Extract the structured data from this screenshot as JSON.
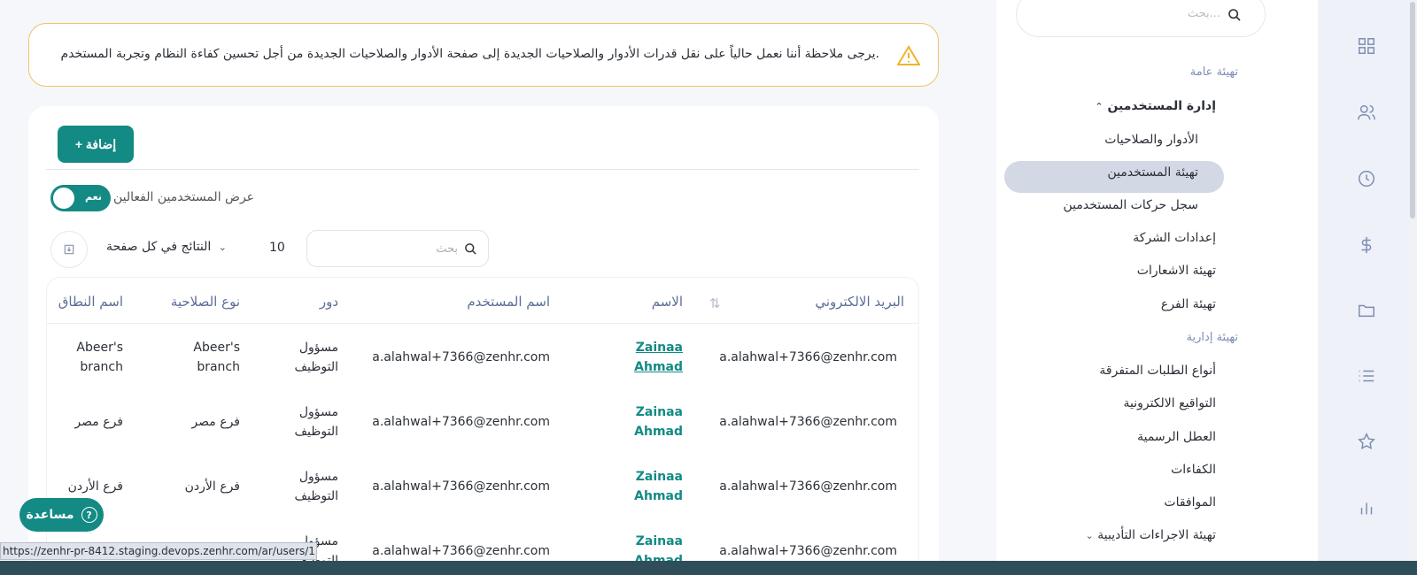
{
  "sidebar": {
    "search_placeholder": "بحث...",
    "section_general": "تهيئة عامة",
    "users_management": "إدارة المستخدمين",
    "items_users": [
      "الأدوار والصلاحيات",
      "تهيئة المستخدمين",
      "سجل حركات المستخدمين"
    ],
    "items_general": [
      "إعدادات الشركة",
      "تهيئة الاشعارات",
      "تهيئة الفرع"
    ],
    "section_admin": "تهيئة إدارية",
    "items_admin": [
      "أنواع الطلبات المتفرقة",
      "التواقيع الالكترونية",
      "العطل الرسمية",
      "الكفاءات",
      "الموافقات",
      "تهيئة الاجراءات التأديبية"
    ],
    "active_item": "تهيئة المستخدمين"
  },
  "rail_icons": [
    "dashboard-icon",
    "users-icon",
    "clock-icon",
    "dollar-icon",
    "folder-icon",
    "list-icon",
    "star-icon",
    "chart-icon"
  ],
  "notice": {
    "text": "يرجى ملاحظة أننا نعمل حالياً على نقل قدرات الأدوار والصلاحيات الجديدة إلى صفحة الأدوار والصلاحيات الجديدة من أجل تحسين كفاءة النظام وتجربة المستخدم."
  },
  "toolbar": {
    "add_label": "+ إضافة",
    "toggle_label": "نعم",
    "toggle_text": "عرض المستخدمين الفعالين",
    "per_page_label": "النتائج في كل صفحة",
    "per_page_value": "10",
    "search_placeholder": "بحث"
  },
  "table": {
    "headers": {
      "email": "البريد الالكتروني",
      "name": "الاسم",
      "username": "اسم المستخدم",
      "role": "دور",
      "permission_type": "نوع الصلاحية",
      "scope_name": "اسم النطاق"
    },
    "rows": [
      {
        "email": "a.alahwal+7366@zenhr.com",
        "name1": "Zainaa",
        "name2": "Ahmad",
        "username": "a.alahwal+7366@zenhr.com",
        "role1": "مسؤول",
        "role2": "التوظيف",
        "perm1": "Abeer's",
        "perm2": "branch",
        "scope1": "Abeer's",
        "scope2": "branch"
      },
      {
        "email": "a.alahwal+7366@zenhr.com",
        "name1": "Zainaa",
        "name2": "Ahmad",
        "username": "a.alahwal+7366@zenhr.com",
        "role1": "مسؤول",
        "role2": "التوظيف",
        "perm1": "فرع مصر",
        "perm2": "",
        "scope1": "فرع مصر",
        "scope2": ""
      },
      {
        "email": "a.alahwal+7366@zenhr.com",
        "name1": "Zainaa",
        "name2": "Ahmad",
        "username": "a.alahwal+7366@zenhr.com",
        "role1": "مسؤول",
        "role2": "التوظيف",
        "perm1": "فرع الأردن",
        "perm2": "",
        "scope1": "فرع الأردن",
        "scope2": ""
      },
      {
        "email": "a.alahwal+7366@zenhr.com",
        "name1": "Zainaa",
        "name2": "Ahmad",
        "username": "a.alahwal+7366@zenhr.com",
        "role1": "مسؤول",
        "role2": "التوظيف",
        "perm1": "",
        "perm2": "",
        "scope1": "",
        "scope2": ""
      }
    ]
  },
  "help_label": "مساعدة",
  "status_url": "https://zenhr-pr-8412.staging.devops.zenhr.com/ar/users/171260",
  "colors": {
    "accent": "#138a84",
    "notice_border": "#f2c265",
    "rail_icon": "#7d8cb4",
    "header_text": "#5b6e98"
  }
}
